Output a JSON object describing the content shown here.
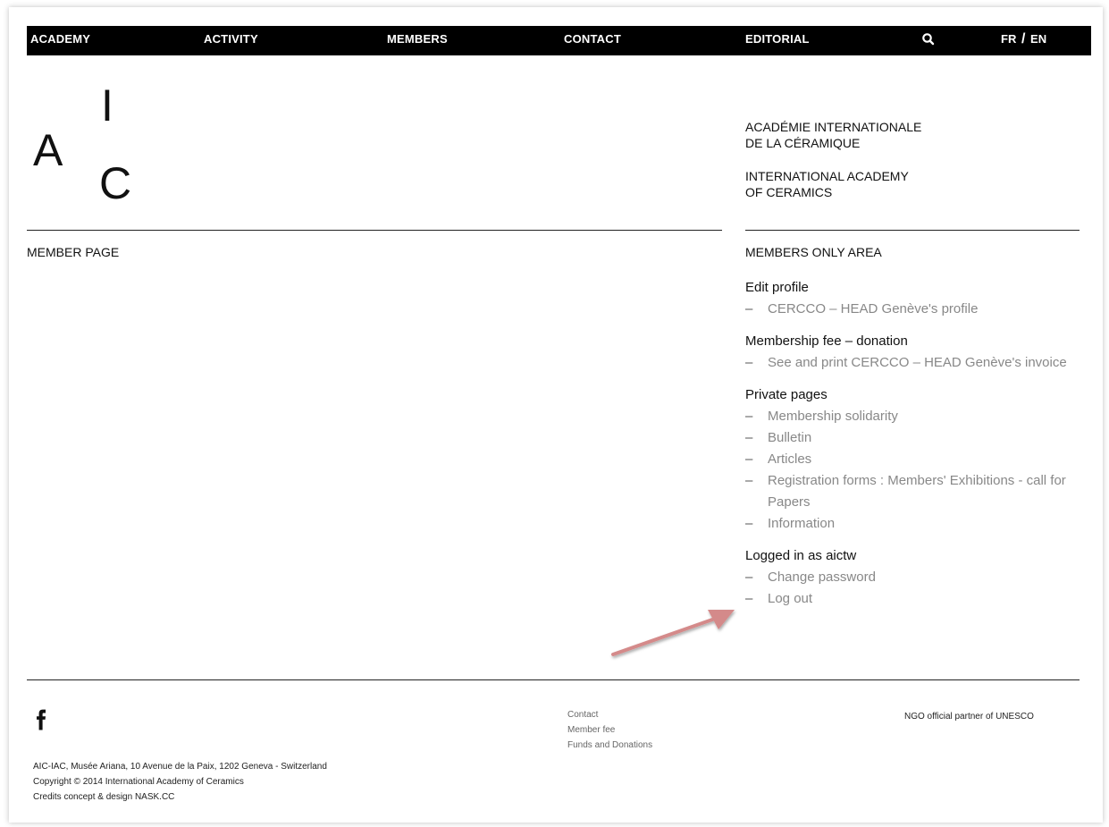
{
  "nav": {
    "items": [
      "ACADEMY",
      "ACTIVITY",
      "MEMBERS",
      "CONTACT",
      "EDITORIAL"
    ],
    "search_icon": "search-icon",
    "lang_fr": "FR",
    "lang_sep": "/",
    "lang_en": "EN"
  },
  "logo": {
    "a": "A",
    "i": "I",
    "c": "C"
  },
  "academy": {
    "fr_line1": "ACADÉMIE INTERNATIONALE",
    "fr_line2": "DE LA CÉRAMIQUE",
    "en_line1": "INTERNATIONAL ACADEMY",
    "en_line2": "OF CERAMICS"
  },
  "main": {
    "title": "MEMBER PAGE"
  },
  "sidebar": {
    "title": "MEMBERS ONLY AREA",
    "groups": [
      {
        "title": "Edit profile",
        "links": [
          "CERCCO – HEAD Genève's profile"
        ]
      },
      {
        "title": "Membership fee – donation",
        "links": [
          "See and print CERCCO – HEAD Genève's invoice"
        ]
      },
      {
        "title": "Private pages",
        "links": [
          "Membership solidarity",
          "Bulletin",
          "Articles",
          "Registration forms : Members' Exhibitions - call for Papers",
          "Information"
        ]
      },
      {
        "title": "Logged in as aictw",
        "links": [
          "Change password",
          "Log out"
        ]
      }
    ],
    "dash": "–"
  },
  "footer": {
    "facebook_icon": "facebook-icon",
    "address": "AIC-IAC, Musée Ariana, 10 Avenue de la Paix, 1202 Geneva - Switzerland",
    "copyright": "Copyright © 2014 International Academy of Ceramics",
    "credits": "Credits concept & design NASK.CC",
    "links": [
      "Contact",
      "Member fee",
      "Funds and Donations"
    ],
    "ngo": "NGO official partner of UNESCO"
  },
  "colors": {
    "nav_bg": "#000000",
    "link_gray": "#888888",
    "annotation_arrow": "#d48a8a"
  }
}
